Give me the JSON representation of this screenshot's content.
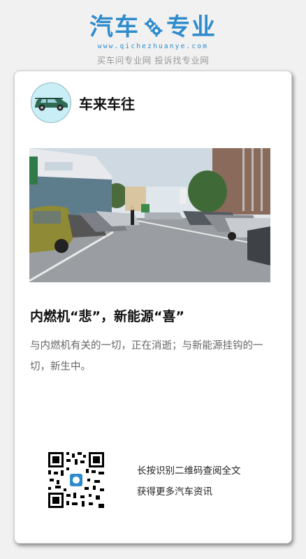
{
  "brand": {
    "logo_left": "汽车",
    "logo_right": "专业",
    "url": "www.qichezhuanye.com",
    "slogan": "买车问专业网 投诉找专业网",
    "color": "#2f8ccc"
  },
  "account": {
    "name": "车来车往",
    "avatar_icon": "green-suv-icon"
  },
  "article": {
    "image_icon": "car-dealership-parking-lot-photo",
    "title": "内燃机“悲”，新能源“喜”",
    "summary": "与内燃机有关的一切，正在消逝；与新能源挂钩的一切，新生中。"
  },
  "share": {
    "qr_icon": "qr-code-icon",
    "line1": "长按识别二维码查阅全文",
    "line2": "获得更多汽车资讯"
  }
}
